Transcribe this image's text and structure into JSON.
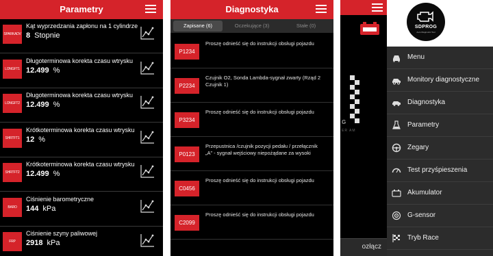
{
  "colors": {
    "accent": "#d5232a",
    "background": "#000000",
    "drawer": "#2c2c2c"
  },
  "params_screen": {
    "title": "Parametry",
    "rows": [
      {
        "code": "SPARKADV",
        "name": "Kąt wyprzedzania zapłonu na 1 cylindrze",
        "value": "8",
        "unit": "Stopnie"
      },
      {
        "code": "LONGFT1",
        "name": "Długoterminowa korekta czasu wtrysku",
        "value": "12.499",
        "unit": "%"
      },
      {
        "code": "LONGFT2",
        "name": "Długoterminowa korekta czasu wtrysku",
        "value": "12.499",
        "unit": "%"
      },
      {
        "code": "SHRTFT1",
        "name": "Krótkoterminowa korekta czasu wtrysku",
        "value": "12",
        "unit": "%"
      },
      {
        "code": "SHRTFT2",
        "name": "Krótkoterminowa korekta czasu wtrysku",
        "value": "12.499",
        "unit": "%"
      },
      {
        "code": "BARO",
        "name": "Ciśnienie barometryczne",
        "value": "144",
        "unit": "kPa"
      },
      {
        "code": "FRP",
        "name": "Ciśnienie szyny paliwowej",
        "value": "2918",
        "unit": "kPa"
      }
    ]
  },
  "diag_screen": {
    "title": "Diagnostyka",
    "tabs": [
      {
        "label": "Zapisane (6)",
        "active": true
      },
      {
        "label": "Oczekujące (3)",
        "active": false
      },
      {
        "label": "Stałe (0)",
        "active": false
      }
    ],
    "codes": [
      {
        "code": "P1234",
        "desc": "Proszę odnieść się do instrukcji obsługi pojazdu"
      },
      {
        "code": "P2234",
        "desc": "Czujnik O2, Sonda Lambda-sygnał zwarty (Rząd 2 Czujnik 1)"
      },
      {
        "code": "P3234",
        "desc": "Proszę odnieść się do instrukcji obsługi pojazdu"
      },
      {
        "code": "P0123",
        "desc": "Przepustnica /czujnik pozycji pedału / przełącznik „A” - sygnał wejściowy niepożądane za wysoki"
      },
      {
        "code": "C0456",
        "desc": "Proszę odnieść się do instrukcji obsługi pojazdu"
      },
      {
        "code": "C2099",
        "desc": "Proszę odnieść się do instrukcji obsługi pojazdu"
      }
    ]
  },
  "menu_screen": {
    "logo_text": "SDPROG",
    "logo_sub": "Auto Diagnostic Tool",
    "bg_text": "G",
    "bg_sub": "ER AM",
    "bottom_button": "ozłącz",
    "items": [
      {
        "label": "Menu",
        "icon": "car-front-icon"
      },
      {
        "label": "Monitory diagnostyczne",
        "icon": "car-side-icon"
      },
      {
        "label": "Diagnostyka",
        "icon": "car-diagnostic-icon"
      },
      {
        "label": "Parametry",
        "icon": "flask-icon"
      },
      {
        "label": "Zegary",
        "icon": "steering-wheel-icon"
      },
      {
        "label": "Test przyśpieszenia",
        "icon": "speedometer-icon"
      },
      {
        "label": "Akumulator",
        "icon": "battery-icon"
      },
      {
        "label": "G-sensor",
        "icon": "target-icon"
      },
      {
        "label": "Tryb Race",
        "icon": "race-flag-icon"
      }
    ]
  }
}
